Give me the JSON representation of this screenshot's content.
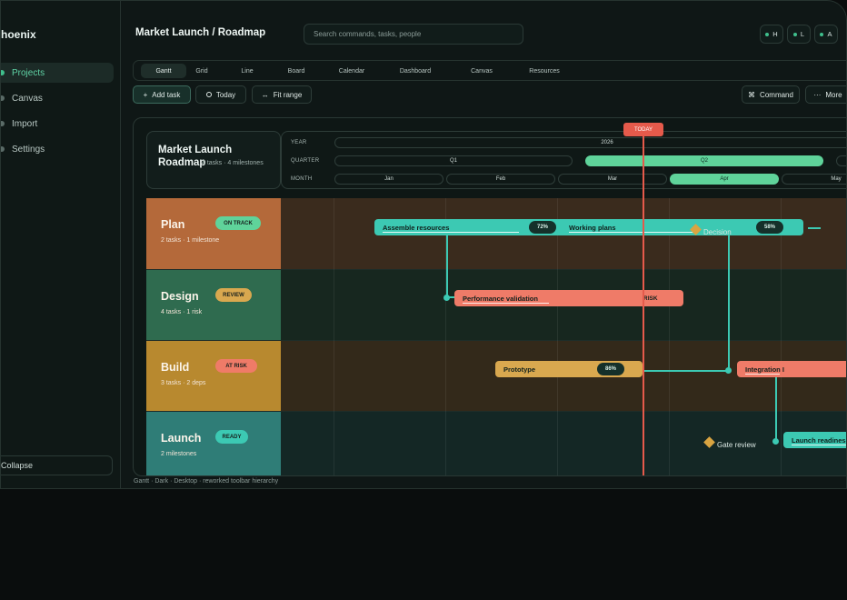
{
  "app": {
    "brand": "hoenix"
  },
  "sidebar": {
    "items": [
      {
        "label": "Projects",
        "active": true
      },
      {
        "label": "Canvas",
        "active": false
      },
      {
        "label": "Import",
        "active": false
      },
      {
        "label": "Settings",
        "active": false
      }
    ],
    "collapse_label": "Collapse"
  },
  "header": {
    "title": "Market Launch / Roadmap",
    "search_placeholder": "Search commands, tasks, people",
    "avatars": [
      "H",
      "L",
      "A"
    ]
  },
  "tabs": [
    "Gantt",
    "Grid",
    "Line",
    "Board",
    "Calendar",
    "Dashboard",
    "Canvas",
    "Resources"
  ],
  "active_tab": "Gantt",
  "toolbar": {
    "add_task": "Add task",
    "today": "Today",
    "fit_range": "Fit range",
    "command": "Command",
    "more": "More"
  },
  "roadmap": {
    "title": "Market Launch",
    "title_line2": "Roadmap",
    "subtitle": "4 tasks · 4 milestones",
    "today_label": "TODAY",
    "timeline": {
      "year_label": "YEAR",
      "year": "2026",
      "quarter_label": "QUARTER",
      "quarters": [
        "Q1",
        "Q2"
      ],
      "month_label": "MONTH",
      "months": [
        "Jan",
        "Feb",
        "Mar",
        "Apr",
        "May"
      ]
    },
    "lanes": [
      {
        "name": "Plan",
        "status": "ON TRACK",
        "meta": "2 tasks · 1 milestone",
        "color": "#b4693a",
        "body": "#3a2b1d",
        "badge": "#5fd39a"
      },
      {
        "name": "Design",
        "status": "REVIEW",
        "meta": "4 tasks · 1 risk",
        "color": "#2f6b4f",
        "body": "#17271f",
        "badge": "#d9a84f"
      },
      {
        "name": "Build",
        "status": "AT RISK",
        "meta": "3 tasks · 2 deps",
        "color": "#b8892f",
        "body": "#33291a",
        "badge": "#ef7b68"
      },
      {
        "name": "Launch",
        "status": "READY",
        "meta": "2 milestones",
        "color": "#2f7d77",
        "body": "#142725",
        "badge": "#3cc9b3"
      }
    ],
    "tasks": {
      "assemble": {
        "label": "Assemble resources",
        "pct": "72%"
      },
      "working": {
        "label": "Working plans",
        "pct": "58%"
      },
      "perf": {
        "label": "Performance validation",
        "tag": "RISK"
      },
      "prototype": {
        "label": "Prototype",
        "pct": "86%"
      },
      "integration": {
        "label": "Integration I"
      },
      "launch_ready": {
        "label": "Launch readiness"
      }
    },
    "milestones": {
      "decision": "Decision",
      "gate": "Gate review"
    }
  },
  "caption": "Gantt · Dark · Desktop · reworked toolbar hierarchy"
}
